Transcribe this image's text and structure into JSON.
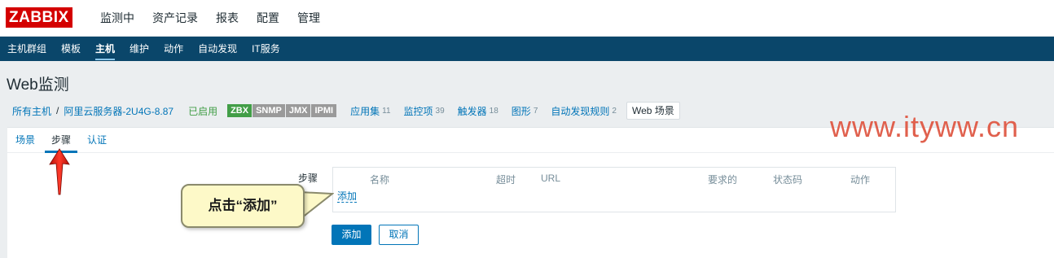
{
  "header": {
    "logo": "ZABBIX",
    "menu": [
      {
        "label": "监测中"
      },
      {
        "label": "资产记录"
      },
      {
        "label": "报表"
      },
      {
        "label": "配置"
      },
      {
        "label": "管理"
      }
    ],
    "active_menu": "配置"
  },
  "subnav": {
    "items": [
      {
        "label": "主机群组"
      },
      {
        "label": "模板"
      },
      {
        "label": "主机"
      },
      {
        "label": "维护"
      },
      {
        "label": "动作"
      },
      {
        "label": "自动发现"
      },
      {
        "label": "IT服务"
      }
    ],
    "active_item": "主机",
    "colors": {
      "background": "#0a466a"
    }
  },
  "page": {
    "title": "Web监测"
  },
  "host_nav": {
    "all_hosts": "所有主机",
    "separator": "/",
    "host_name": "阿里云服务器-2U4G-8.87",
    "status": "已启用",
    "availability": [
      "ZBX",
      "SNMP",
      "JMX",
      "IPMI"
    ],
    "links": [
      {
        "label": "应用集",
        "count": "11"
      },
      {
        "label": "监控项",
        "count": "39"
      },
      {
        "label": "触发器",
        "count": "18"
      },
      {
        "label": "图形",
        "count": "7"
      },
      {
        "label": "自动发现规则",
        "count": "2"
      }
    ],
    "web_scenarios": "Web 场景"
  },
  "tabs": [
    {
      "label": "场景"
    },
    {
      "label": "步骤"
    },
    {
      "label": "认证"
    }
  ],
  "active_tab": "步骤",
  "form": {
    "steps_label": "步骤",
    "columns": [
      "名称",
      "超时",
      "URL",
      "要求的",
      "状态码",
      "动作"
    ],
    "add_link": "添加",
    "add_button": "添加",
    "cancel_button": "取消"
  },
  "annotation": {
    "callout_text": "点击“添加”",
    "arrow_icon": "red-up-arrow-icon",
    "watermark": "www.ityww.cn",
    "colors": {
      "callout_bg": "#fdf9c8",
      "arrow": "#e8261a",
      "watermark": "#e0604d"
    }
  }
}
